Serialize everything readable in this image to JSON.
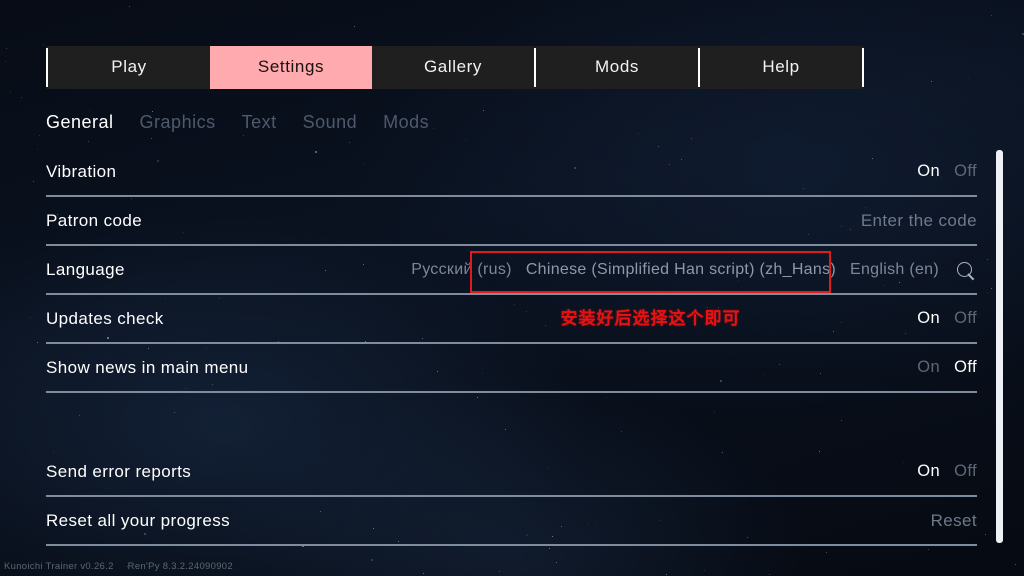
{
  "background": {
    "base_color": "#060a12",
    "accent_color": "#ffaaae",
    "annotation_color": "#e01b1b"
  },
  "tabbar": {
    "tabs": [
      {
        "label": "Play",
        "active": false
      },
      {
        "label": "Settings",
        "active": true
      },
      {
        "label": "Gallery",
        "active": false
      },
      {
        "label": "Mods",
        "active": false
      },
      {
        "label": "Help",
        "active": false
      }
    ]
  },
  "subtabs": [
    {
      "label": "General",
      "active": true
    },
    {
      "label": "Graphics",
      "active": false
    },
    {
      "label": "Text",
      "active": false
    },
    {
      "label": "Sound",
      "active": false
    },
    {
      "label": "Mods",
      "active": false
    }
  ],
  "settings": {
    "vibration": {
      "label": "Vibration",
      "on": "On",
      "off": "Off",
      "selected": "On"
    },
    "patron": {
      "label": "Patron code",
      "placeholder": "Enter the code"
    },
    "language": {
      "label": "Language",
      "options": [
        {
          "text": "Русский (rus)",
          "boxed": false
        },
        {
          "text": "Chinese (Simplified Han script) (zh_Hans)",
          "boxed": true
        },
        {
          "text": "English (en)",
          "boxed": false
        }
      ],
      "search_icon": "search-icon"
    },
    "updates": {
      "label": "Updates check",
      "on": "On",
      "off": "Off",
      "selected": "On"
    },
    "shownews": {
      "label": "Show news in main menu",
      "on": "On",
      "off": "Off",
      "selected": "Off"
    },
    "errorreports": {
      "label": "Send error reports",
      "on": "On",
      "off": "Off",
      "selected": "On"
    },
    "reset": {
      "label": "Reset all your progress",
      "action": "Reset"
    }
  },
  "annotation": {
    "text": "安装好后选择这个即可"
  },
  "footer": {
    "game": "Kunoichi Trainer v0.26.2",
    "engine": "Ren'Py 8.3.2.24090902"
  }
}
